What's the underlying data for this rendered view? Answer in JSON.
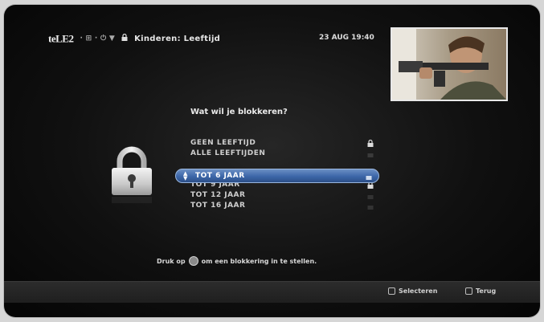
{
  "header": {
    "logo": "teLE2",
    "logo_sup": "",
    "breadcrumb": "· ⊞ · ⏻ ▼",
    "title": "Kinderen: Leeftijd",
    "datetime": "23 AUG 19:40"
  },
  "main": {
    "question": "Wat wil je blokkeren?",
    "options": [
      {
        "label": "GEEN LEEFTIJD",
        "locked": true
      },
      {
        "label": "ALLE LEEFTIJDEN",
        "locked": false
      },
      {
        "label": "TOT 6 JAAR",
        "locked": false,
        "selected": true
      },
      {
        "label": "TOT 9 JAAR",
        "locked": true
      },
      {
        "label": "TOT 12 JAAR",
        "locked": false
      },
      {
        "label": "TOT 16 JAAR",
        "locked": false
      }
    ],
    "hint_before": "Druk op",
    "hint_after": "om een blokkering in te stellen."
  },
  "footer": {
    "select_label": "Selecteren",
    "back_label": "Terug"
  },
  "icons": {
    "big_lock": "padlock-icon",
    "small_lock": "padlock-icon",
    "ok_button": "ok-button-icon",
    "select_button": "select-button-icon",
    "back_button": "back-button-icon"
  },
  "colors": {
    "selection": "#3c66a8",
    "background": "#101010",
    "text": "#cfcfcf"
  }
}
